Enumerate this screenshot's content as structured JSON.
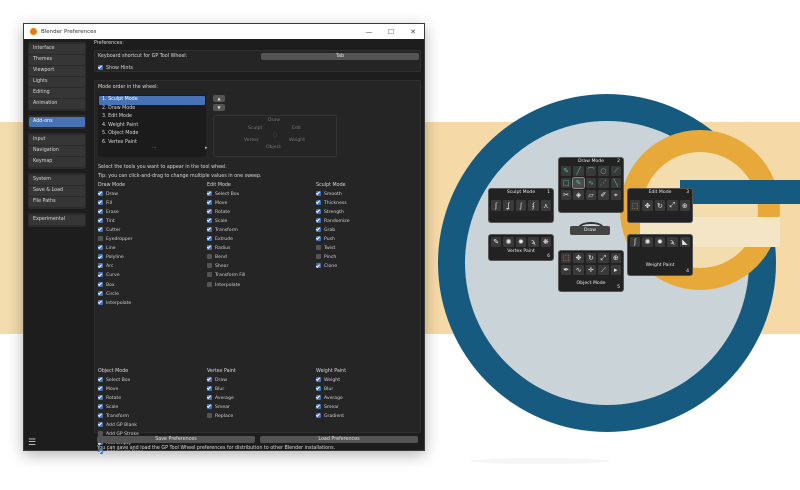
{
  "window": {
    "title": "Blender Preferences",
    "minimize": "—",
    "maximize": "☐",
    "close": "✕"
  },
  "sidebar": {
    "groups": [
      [
        "Interface",
        "Themes",
        "Viewport",
        "Lights",
        "Editing",
        "Animation"
      ],
      [
        "Add-ons"
      ],
      [
        "Input",
        "Navigation",
        "Keymap"
      ],
      [
        "System",
        "Save & Load",
        "File Paths"
      ],
      [
        "Experimental"
      ]
    ],
    "active": "Add-ons",
    "menu_icon": "☰"
  },
  "prefs": {
    "header": "Preferences:",
    "shortcut_label": "Keyboard shortcut for GP Tool Wheel:",
    "shortcut_value": "Tab",
    "show_hints": "Show Hints",
    "mode_order_label": "Mode order in the wheel:",
    "modes": [
      "1. Sculpt Mode",
      "2. Draw Mode",
      "3. Edit Mode",
      "4. Weight Paint",
      "5. Object Mode",
      "6. Vertex Paint"
    ],
    "modes_more": "...",
    "mode_up": "▲",
    "mode_down": "▼",
    "preview": {
      "top": "Draw",
      "left": "Sculpt",
      "right": "Edit",
      "bottom_left": "Vertex",
      "bottom_right": "Weight",
      "bottom": "Object"
    },
    "tools_label": "Select the tools you want to appear in the tool wheel.",
    "tip": "Tip: you can click-and-drag to change multiple values in one sweep.",
    "save_btn": "Save Preferences",
    "load_btn": "Load Preferences",
    "footer": "You can save and load the GP Tool Wheel preferences for distribution to other Blender installations."
  },
  "tool_columns": [
    {
      "title": "Draw Mode",
      "items": [
        [
          "Draw",
          true
        ],
        [
          "Fill",
          true
        ],
        [
          "Erase",
          true
        ],
        [
          "Tint",
          true
        ],
        [
          "Cutter",
          true
        ],
        [
          "Eyedropper",
          false
        ],
        [
          "Line",
          true
        ],
        [
          "Polyline",
          true
        ],
        [
          "Arc",
          true
        ],
        [
          "Curve",
          true
        ],
        [
          "Box",
          true
        ],
        [
          "Circle",
          true
        ],
        [
          "Interpolate",
          true
        ]
      ]
    },
    {
      "title": "Edit Mode",
      "items": [
        [
          "Select Box",
          true
        ],
        [
          "Move",
          true
        ],
        [
          "Rotate",
          true
        ],
        [
          "Scale",
          true
        ],
        [
          "Transform",
          true
        ],
        [
          "Extrude",
          true
        ],
        [
          "Radius",
          true
        ],
        [
          "Bend",
          false
        ],
        [
          "Shear",
          false
        ],
        [
          "Transform Fill",
          false
        ],
        [
          "Interpolate",
          false
        ]
      ]
    },
    {
      "title": "Sculpt Mode",
      "items": [
        [
          "Smooth",
          true
        ],
        [
          "Thickness",
          true
        ],
        [
          "Strength",
          true
        ],
        [
          "Randomize",
          true
        ],
        [
          "Grab",
          true
        ],
        [
          "Push",
          true
        ],
        [
          "Twist",
          false
        ],
        [
          "Pinch",
          false
        ],
        [
          "Clone",
          true
        ]
      ]
    },
    {
      "title": "Object Mode",
      "items": [
        [
          "Select Box",
          true
        ],
        [
          "Move",
          true
        ],
        [
          "Rotate",
          true
        ],
        [
          "Scale",
          true
        ],
        [
          "Transform",
          true
        ],
        [
          "Add GP Blank",
          true
        ],
        [
          "Add GP Stroke",
          false
        ],
        [
          "Add Empty",
          true
        ],
        [
          "Add Single Bone",
          true
        ]
      ]
    },
    {
      "title": "Vertex Paint",
      "items": [
        [
          "Draw",
          true
        ],
        [
          "Blur",
          true
        ],
        [
          "Average",
          true
        ],
        [
          "Smear",
          true
        ],
        [
          "Replace",
          false
        ]
      ]
    },
    {
      "title": "Weight Paint",
      "items": [
        [
          "Weight",
          true
        ],
        [
          "Blur",
          true
        ],
        [
          "Average",
          true
        ],
        [
          "Smear",
          true
        ],
        [
          "Gradient",
          true
        ]
      ]
    }
  ],
  "pie": {
    "draw_title": "Draw Mode",
    "draw_num": "2",
    "sculpt_title": "Sculpt Mode",
    "sculpt_num": "1",
    "edit_title": "Edit Mode",
    "edit_num": "3",
    "vertex_title": "Vertex Paint",
    "vertex_num": "6",
    "weight_title": "Weight Paint",
    "weight_num": "4",
    "object_title": "Object Mode",
    "object_num": "5",
    "center": "Draw",
    "colors": {
      "accent": "#4fc3a1",
      "blue": "#175a80",
      "orange": "#e7a93a",
      "band": "#f3dcae"
    }
  }
}
